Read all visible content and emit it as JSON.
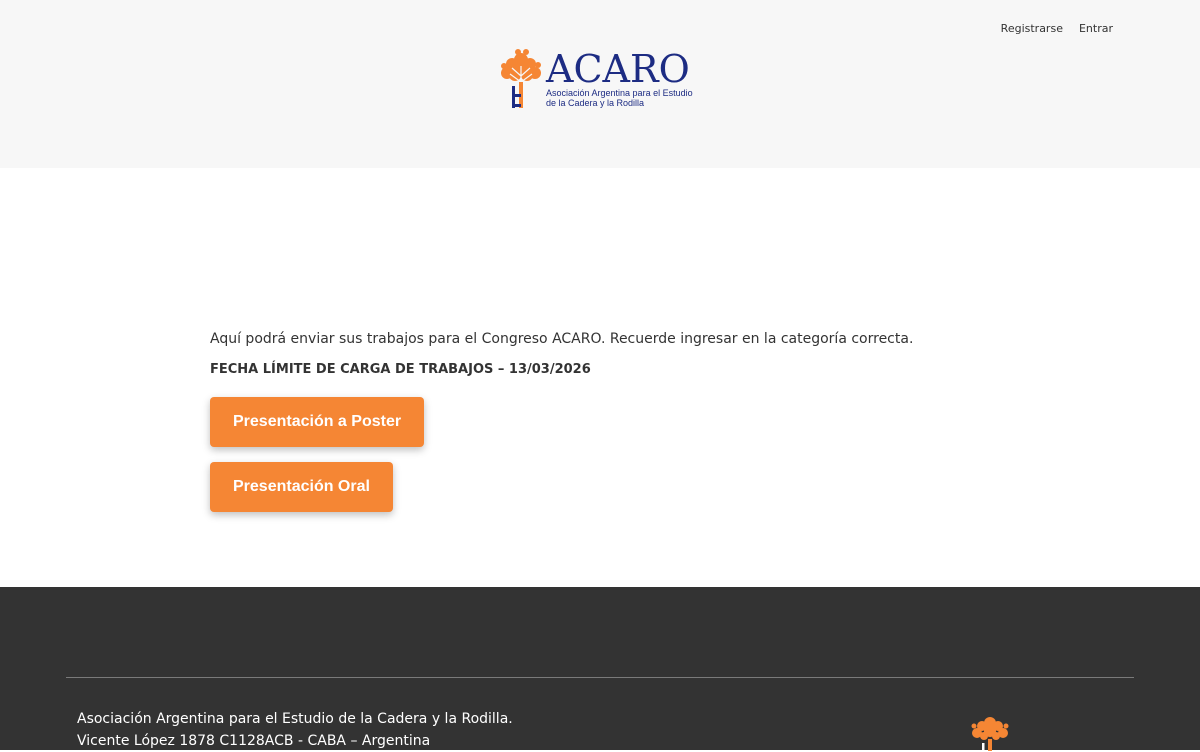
{
  "nav": {
    "register": "Registrarse",
    "login": "Entrar"
  },
  "logo": {
    "name": "ACARO",
    "subtitle_line1": "Asociación Argentina para el Estudio",
    "subtitle_line2": "de la Cadera y la Rodilla"
  },
  "main": {
    "intro": "Aquí podrá enviar sus trabajos para el Congreso ACARO. Recuerde ingresar en la categoría correcta.",
    "deadline": "FECHA LÍMITE DE CARGA DE TRABAJOS – 13/03/2026",
    "buttons": {
      "poster": "Presentación a Poster",
      "oral": "Presentación Oral"
    }
  },
  "footer": {
    "line1": "Asociación Argentina para el Estudio de la Cadera y la Rodilla.",
    "line2": "Vicente López 1878 C1128ACB - CABA – Argentina"
  },
  "colors": {
    "accent": "#f58634",
    "brand": "#1d2c83",
    "header_bg": "#f7f7f7",
    "footer_bg": "#333333"
  },
  "icons": {
    "logo": "tree-icon"
  }
}
